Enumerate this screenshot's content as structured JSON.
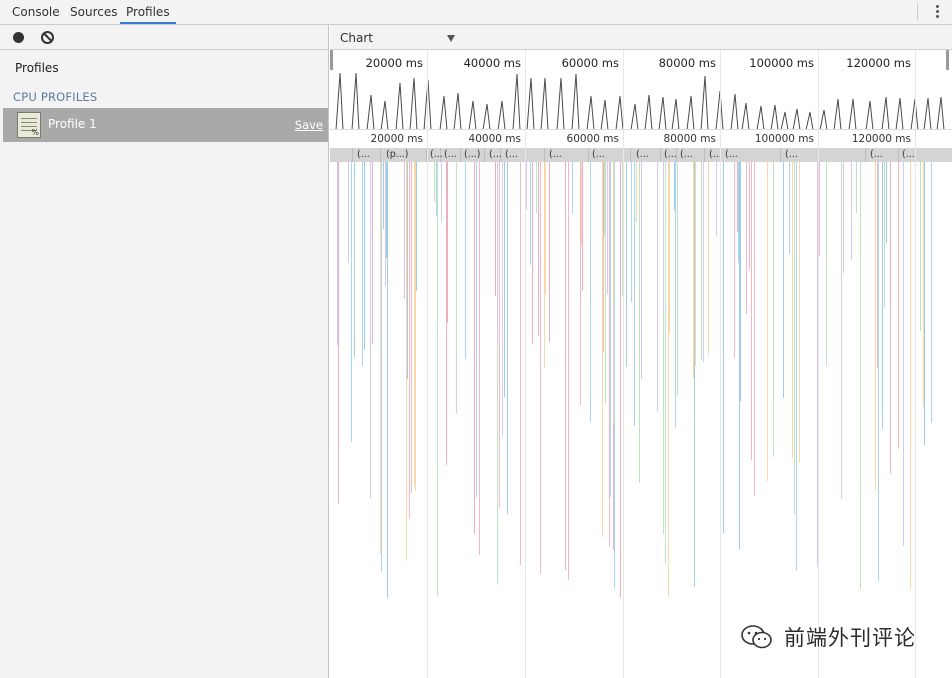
{
  "tabs": [
    {
      "label": "Console",
      "active": false
    },
    {
      "label": "Sources",
      "active": false
    },
    {
      "label": "Profiles",
      "active": true
    }
  ],
  "left_panel": {
    "record_icon": "record-icon",
    "clear_icon": "clear-icon",
    "heading": "Profiles",
    "section_title": "CPU PROFILES",
    "profile": {
      "name": "Profile 1",
      "save_label": "Save",
      "icon": "cpu-profile-icon"
    }
  },
  "right_panel": {
    "view_select": "Chart",
    "overview_ticks": [
      "20000 ms",
      "40000 ms",
      "60000 ms",
      "80000 ms",
      "100000 ms",
      "120000 ms"
    ],
    "ruler_ticks": [
      "20000 ms",
      "40000 ms",
      "60000 ms",
      "80000 ms",
      "100000 ms",
      "120000 ms"
    ],
    "top_frame_labels": [
      "(...",
      "(p...)",
      "(...",
      "(...",
      "(...)",
      "(...",
      "(...",
      "(...",
      "(...",
      "(...",
      "(...",
      "(...",
      "(...",
      "(...",
      "(...",
      "(...",
      "(..."
    ]
  },
  "watermark": {
    "text": "前端外刊评论"
  },
  "colors": {
    "accent": "#3879d9",
    "selected_row": "#a9a9a9",
    "panel_bg": "#f3f3f3"
  }
}
